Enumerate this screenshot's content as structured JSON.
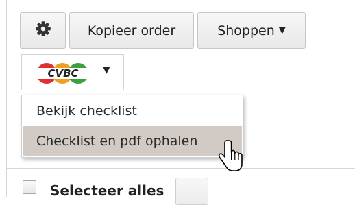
{
  "toolbar": {
    "settings_icon": "gear-icon",
    "copy_order_label": "Kopieer order",
    "shop_label": "Shoppen",
    "shop_caret": "▼"
  },
  "brand": {
    "logo_text": "CVBC",
    "logo_colors": [
      "#e03030",
      "#f0a020",
      "#3aa040"
    ],
    "caret": "▼"
  },
  "dropdown": {
    "items": [
      {
        "label": "Bekijk checklist"
      },
      {
        "label": "Checklist en pdf ophalen"
      }
    ],
    "hovered_index": 1
  },
  "cursor_icon": "hand-pointer-icon",
  "bottom": {
    "select_all_label": "Selecteer alles"
  }
}
